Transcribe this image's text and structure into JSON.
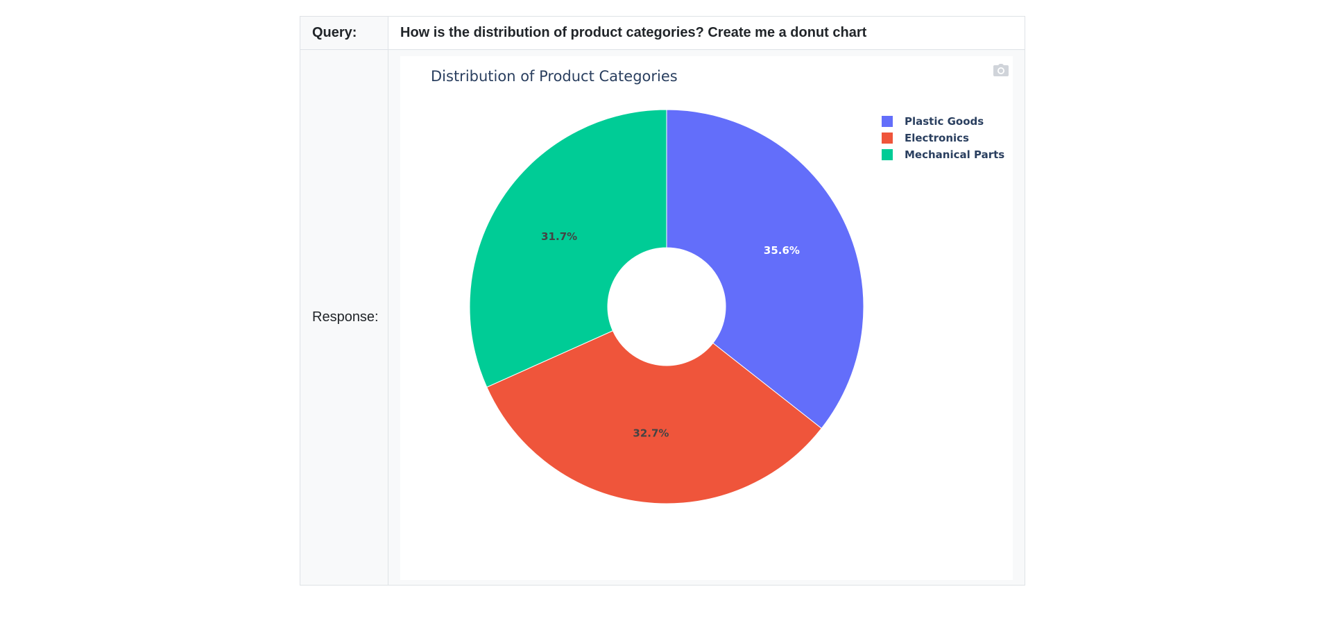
{
  "query": {
    "label": "Query:",
    "text": "How is the distribution of product categories? Create me a donut chart"
  },
  "response": {
    "label": "Response:"
  },
  "icons": {
    "camera": "camera-icon"
  },
  "chart_data": {
    "type": "pie",
    "hole": true,
    "title": "Distribution of Product Categories",
    "legend_position": "top-right",
    "slices": [
      {
        "label": "Plastic Goods",
        "value": 35.6,
        "display": "35.6%",
        "color": "#636efa",
        "text_color": "#ffffff"
      },
      {
        "label": "Electronics",
        "value": 32.7,
        "display": "32.7%",
        "color": "#ef553b",
        "text_color": "#444444"
      },
      {
        "label": "Mechanical Parts",
        "value": 31.7,
        "display": "31.7%",
        "color": "#00cc96",
        "text_color": "#444444"
      }
    ]
  }
}
